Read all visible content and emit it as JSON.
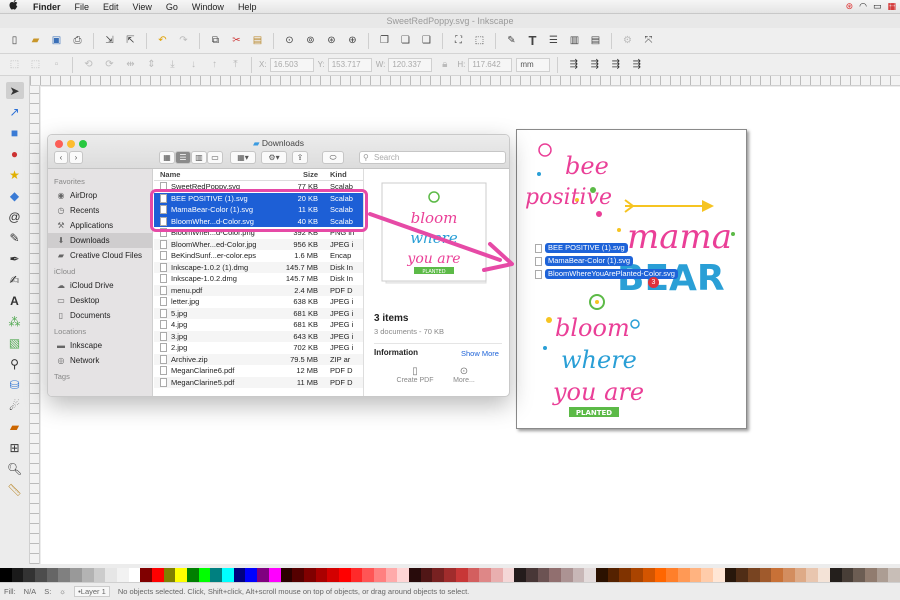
{
  "menubar": {
    "apple": "",
    "items": [
      "Finder",
      "File",
      "Edit",
      "View",
      "Go",
      "Window",
      "Help"
    ]
  },
  "window_title": "SweetRedPoppy.svg - Inkscape",
  "controls": {
    "x_label": "X:",
    "x_value": "16.503",
    "y_label": "Y:",
    "y_value": "153.717",
    "w_label": "W:",
    "w_value": "120.337",
    "h_label": "H:",
    "h_value": "117.642",
    "unit": "mm"
  },
  "statusbar": {
    "fill_label": "Fill:",
    "fill_value": "N/A",
    "stroke_label": "S:",
    "layer": "•Layer 1",
    "message": "No objects selected. Click, Shift+click, Alt+scroll mouse on top of objects, or drag around objects to select."
  },
  "finder": {
    "title": "Downloads",
    "search_placeholder": "Search",
    "sidebar": {
      "favorites_header": "Favorites",
      "favorites": [
        {
          "label": "AirDrop",
          "icon": "airdrop-icon"
        },
        {
          "label": "Recents",
          "icon": "clock-icon"
        },
        {
          "label": "Applications",
          "icon": "applications-icon"
        },
        {
          "label": "Downloads",
          "icon": "download-icon"
        },
        {
          "label": "Creative Cloud Files",
          "icon": "folder-icon"
        }
      ],
      "icloud_header": "iCloud",
      "icloud": [
        {
          "label": "iCloud Drive",
          "icon": "cloud-icon"
        },
        {
          "label": "Desktop",
          "icon": "desktop-icon"
        },
        {
          "label": "Documents",
          "icon": "document-icon"
        }
      ],
      "locations_header": "Locations",
      "locations": [
        {
          "label": "Inkscape",
          "icon": "drive-icon"
        },
        {
          "label": "Network",
          "icon": "network-icon"
        }
      ],
      "tags_header": "Tags"
    },
    "columns": {
      "name": "Name",
      "size": "Size",
      "kind": "Kind"
    },
    "files": [
      {
        "name": "SweetRedPoppy.svg",
        "size": "77 KB",
        "kind": "Scalab",
        "sel": false
      },
      {
        "name": "BEE POSITIVE (1).svg",
        "size": "20 KB",
        "kind": "Scalab",
        "sel": true
      },
      {
        "name": "MamaBear-Color (1).svg",
        "size": "11 KB",
        "kind": "Scalab",
        "sel": true
      },
      {
        "name": "BloomWher...d-Color.svg",
        "size": "40 KB",
        "kind": "Scalab",
        "sel": true
      },
      {
        "name": "BloomWher...d-Color.png",
        "size": "392 KB",
        "kind": "PNG in",
        "sel": false
      },
      {
        "name": "BloomWher...ed-Color.jpg",
        "size": "956 KB",
        "kind": "JPEG i",
        "sel": false
      },
      {
        "name": "BeKindSunf...er-color.eps",
        "size": "1.6 MB",
        "kind": "Encap",
        "sel": false
      },
      {
        "name": "Inkscape-1.0.2 (1).dmg",
        "size": "145.7 MB",
        "kind": "Disk In",
        "sel": false
      },
      {
        "name": "Inkscape-1.0.2.dmg",
        "size": "145.7 MB",
        "kind": "Disk In",
        "sel": false
      },
      {
        "name": "menu.pdf",
        "size": "2.4 MB",
        "kind": "PDF D",
        "sel": false
      },
      {
        "name": "letter.jpg",
        "size": "638 KB",
        "kind": "JPEG i",
        "sel": false
      },
      {
        "name": "5.jpg",
        "size": "681 KB",
        "kind": "JPEG i",
        "sel": false
      },
      {
        "name": "4.jpg",
        "size": "681 KB",
        "kind": "JPEG i",
        "sel": false
      },
      {
        "name": "3.jpg",
        "size": "643 KB",
        "kind": "JPEG i",
        "sel": false
      },
      {
        "name": "2.jpg",
        "size": "702 KB",
        "kind": "JPEG i",
        "sel": false
      },
      {
        "name": "Archive.zip",
        "size": "79.5 MB",
        "kind": "ZIP ar",
        "sel": false
      },
      {
        "name": "MeganClarine6.pdf",
        "size": "12 MB",
        "kind": "PDF D",
        "sel": false
      },
      {
        "name": "MeganClarine5.pdf",
        "size": "11 MB",
        "kind": "PDF D",
        "sel": false
      }
    ],
    "preview": {
      "count": "3 items",
      "detail": "3 documents - 70 KB",
      "info_label": "Information",
      "show_more": "Show More",
      "create_pdf": "Create PDF",
      "more": "More...",
      "art": {
        "line1": "bloom",
        "line2": "where",
        "line3": "you are",
        "ribbon": "PLANTED"
      }
    }
  },
  "canvas_art": {
    "bee": {
      "line1": "bee",
      "line2": "positive"
    },
    "mama": {
      "line1": "mama",
      "line2": "BEAR"
    },
    "bloom": {
      "line1": "bloom",
      "line2": "where",
      "line3": "you are",
      "ribbon": "PLANTED"
    }
  },
  "drag": {
    "items": [
      "BEE POSITIVE (1).svg",
      "MamaBear-Color (1).svg",
      "BloomWhereYouArePlanted-Color.svg"
    ],
    "badge": "3"
  },
  "colors": {
    "selection": "#1d5fd6",
    "highlight": "#e64aa6",
    "pink": "#ea3f97",
    "blue": "#2a9fd6",
    "green": "#5cba47",
    "yellow": "#f6c421"
  },
  "palette": [
    "#000000",
    "#1a1a1a",
    "#333333",
    "#4d4d4d",
    "#666666",
    "#808080",
    "#999999",
    "#b3b3b3",
    "#cccccc",
    "#e6e6e6",
    "#f2f2f2",
    "#ffffff",
    "#800000",
    "#ff0000",
    "#808000",
    "#ffff00",
    "#008000",
    "#00ff00",
    "#008080",
    "#00ffff",
    "#000080",
    "#0000ff",
    "#800080",
    "#ff00ff",
    "#2b0000",
    "#550000",
    "#800000",
    "#aa0000",
    "#d40000",
    "#ff0000",
    "#ff2a2a",
    "#ff5555",
    "#ff8080",
    "#ffaaaa",
    "#ffd5d5",
    "#280b0b",
    "#501616",
    "#782121",
    "#a02c2c",
    "#c83737",
    "#d35f5f",
    "#de8787",
    "#e9afaf",
    "#f4d7d7",
    "#241c1c",
    "#483737",
    "#6c5353",
    "#916f6f",
    "#ac9393",
    "#c8b7b7",
    "#e3dbdb",
    "#2b1100",
    "#552200",
    "#803300",
    "#aa4400",
    "#d45500",
    "#ff6600",
    "#ff7f2a",
    "#ff9955",
    "#ffb380",
    "#ffccaa",
    "#ffe6d5",
    "#28170b",
    "#502d16",
    "#784421",
    "#a05a2c",
    "#c87137",
    "#d38d5f",
    "#deaa87",
    "#e9c6af",
    "#f4e3d7",
    "#241f1c",
    "#483e37",
    "#6c5d53",
    "#917c6f",
    "#ac9d93",
    "#c8beb7"
  ]
}
